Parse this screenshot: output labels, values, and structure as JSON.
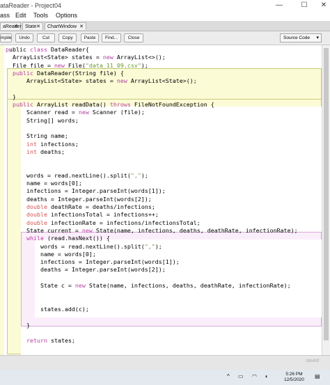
{
  "window": {
    "title": "ataReader - Project04",
    "minimize": "—",
    "maximize": "☐",
    "close": "✕"
  },
  "menu": [
    "ass",
    "Edit",
    "Tools",
    "Options"
  ],
  "tabs": [
    {
      "label": "aReader",
      "close": "✕"
    },
    {
      "label": "State",
      "close": "✕"
    },
    {
      "label": "ChartWindow",
      "close": "✕"
    }
  ],
  "toolbar": {
    "buttons": [
      "mpile",
      "Undo",
      "Cut",
      "Copy",
      "Paste",
      "Find...",
      "Close"
    ],
    "view_select": "Source Code",
    "view_caret": "▾"
  },
  "code": [
    "ublic class DataReader{",
    "  ArrayList<State> states = new ArrayList<>();",
    "  File file = new File(\"data_11_09.csv\");",
    "  public DataReader(String file) {",
    "      ArrayList<State> states = new ArrayList<State>();",
    "",
    "  }",
    "  public ArrayList readData() throws FileNotFoundException {",
    "      Scanner read = new Scanner (file);",
    "      String[] words;",
    "",
    "      String name;",
    "      int infections;",
    "      int deaths;",
    "",
    "",
    "      words = read.nextLine().split(\",\");",
    "      name = words[0];",
    "      infections = Integer.parseInt(words[1]);",
    "      deaths = Integer.parseInt(words[2]);",
    "      double deathRate = deaths/infections;",
    "      double infectionsTotal = infections++;",
    "      double infectionRate = infections/infectionsTotal;",
    "      State current = new State(name, infections, deaths, deathRate, infectionRate);",
    "      while (read.hasNext()) {",
    "          words = read.nextLine().split(\",\");",
    "          name = words[0];",
    "          infections = Integer.parseInt(words[1]);",
    "          deaths = Integer.parseInt(words[2]);",
    "",
    "          State c = new State(name, infections, deaths, deathRate, infectionRate);",
    "",
    "",
    "          states.add(c);",
    "",
    "      }",
    "",
    "      return states;"
  ],
  "status": {
    "text": "saved"
  },
  "taskbar": {
    "caret": "^",
    "time": "5:26 PM",
    "date": "12/5/2020"
  },
  "colors": {
    "keyword": "#b63fa3",
    "type": "#d25252",
    "string": "#6a9a2d",
    "method_block": "#fbfbd6",
    "loop_block": "#fbeefb"
  }
}
